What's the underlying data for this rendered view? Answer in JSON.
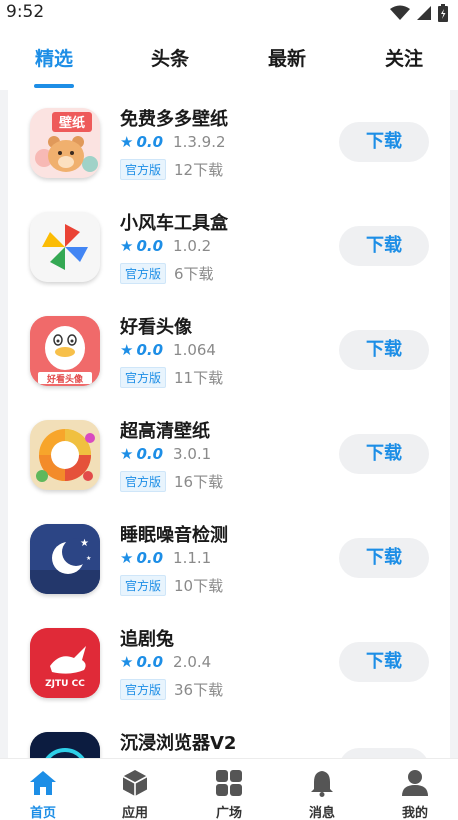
{
  "status": {
    "time": "9:52"
  },
  "tabs": [
    {
      "label": "精选",
      "active": true
    },
    {
      "label": "头条",
      "active": false
    },
    {
      "label": "最新",
      "active": false
    },
    {
      "label": "关注",
      "active": false
    }
  ],
  "apps": [
    {
      "name": "免费多多壁纸",
      "rating": "0.0",
      "version": "1.3.9.2",
      "badge": "官方版",
      "downloads": "12下载",
      "button": "下载",
      "icon": "wallpaper-bear-icon",
      "icon_text": "壁纸"
    },
    {
      "name": "小风车工具盒",
      "rating": "0.0",
      "version": "1.0.2",
      "badge": "官方版",
      "downloads": "6下载",
      "button": "下载",
      "icon": "pinwheel-icon"
    },
    {
      "name": "好看头像",
      "rating": "0.0",
      "version": "1.064",
      "badge": "官方版",
      "downloads": "11下载",
      "button": "下载",
      "icon": "duck-avatar-icon",
      "icon_text": "好看头像"
    },
    {
      "name": "超高清壁纸",
      "rating": "0.0",
      "version": "3.0.1",
      "badge": "官方版",
      "downloads": "16下载",
      "button": "下载",
      "icon": "color-ring-icon"
    },
    {
      "name": "睡眠噪音检测",
      "rating": "0.0",
      "version": "1.1.1",
      "badge": "官方版",
      "downloads": "10下载",
      "button": "下载",
      "icon": "moon-icon"
    },
    {
      "name": "追剧兔",
      "rating": "0.0",
      "version": "2.0.4",
      "badge": "官方版",
      "downloads": "36下载",
      "button": "下载",
      "icon": "rabbit-icon",
      "icon_text": "ZJTU CC"
    },
    {
      "name": "沉浸浏览器V2",
      "rating": "",
      "version": "",
      "badge": "",
      "downloads": "",
      "button": "",
      "icon": "browser-icon"
    }
  ],
  "bottom_nav": [
    {
      "label": "首页",
      "icon": "home-icon",
      "active": true
    },
    {
      "label": "应用",
      "icon": "cube-icon",
      "active": false
    },
    {
      "label": "广场",
      "icon": "grid-icon",
      "active": false
    },
    {
      "label": "消息",
      "icon": "bell-icon",
      "active": false
    },
    {
      "label": "我的",
      "icon": "user-icon",
      "active": false
    }
  ],
  "colors": {
    "accent": "#1d8ee6",
    "badge_bg": "#e8f4fd",
    "button_bg": "#eff0f2",
    "page_bg": "#f2f3f5"
  }
}
